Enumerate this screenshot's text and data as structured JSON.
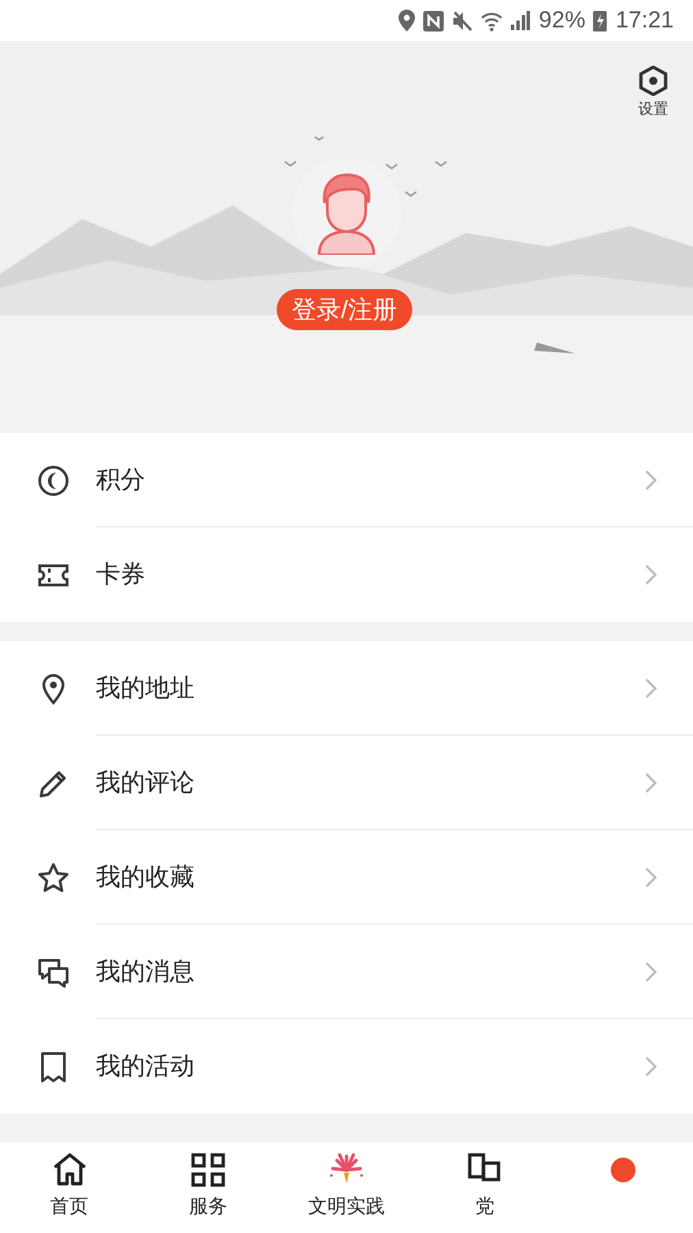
{
  "status_bar": {
    "battery": "92%",
    "time": "17:21"
  },
  "header": {
    "settings_label": "设置",
    "login_button": "登录/注册"
  },
  "groups": [
    {
      "items": [
        {
          "kind": "coin",
          "label": "积分"
        },
        {
          "kind": "ticket",
          "label": "卡券"
        }
      ]
    },
    {
      "items": [
        {
          "kind": "pin",
          "label": "我的地址"
        },
        {
          "kind": "pencil",
          "label": "我的评论"
        },
        {
          "kind": "star",
          "label": "我的收藏"
        },
        {
          "kind": "chat",
          "label": "我的消息"
        },
        {
          "kind": "bookmark",
          "label": "我的活动"
        }
      ]
    }
  ],
  "tab_bar": [
    {
      "kind": "home",
      "label": "首页"
    },
    {
      "kind": "grid",
      "label": "服务"
    },
    {
      "kind": "firework",
      "label": "文明实践"
    },
    {
      "kind": "squares",
      "label": "党"
    },
    {
      "kind": "sun"
    }
  ]
}
